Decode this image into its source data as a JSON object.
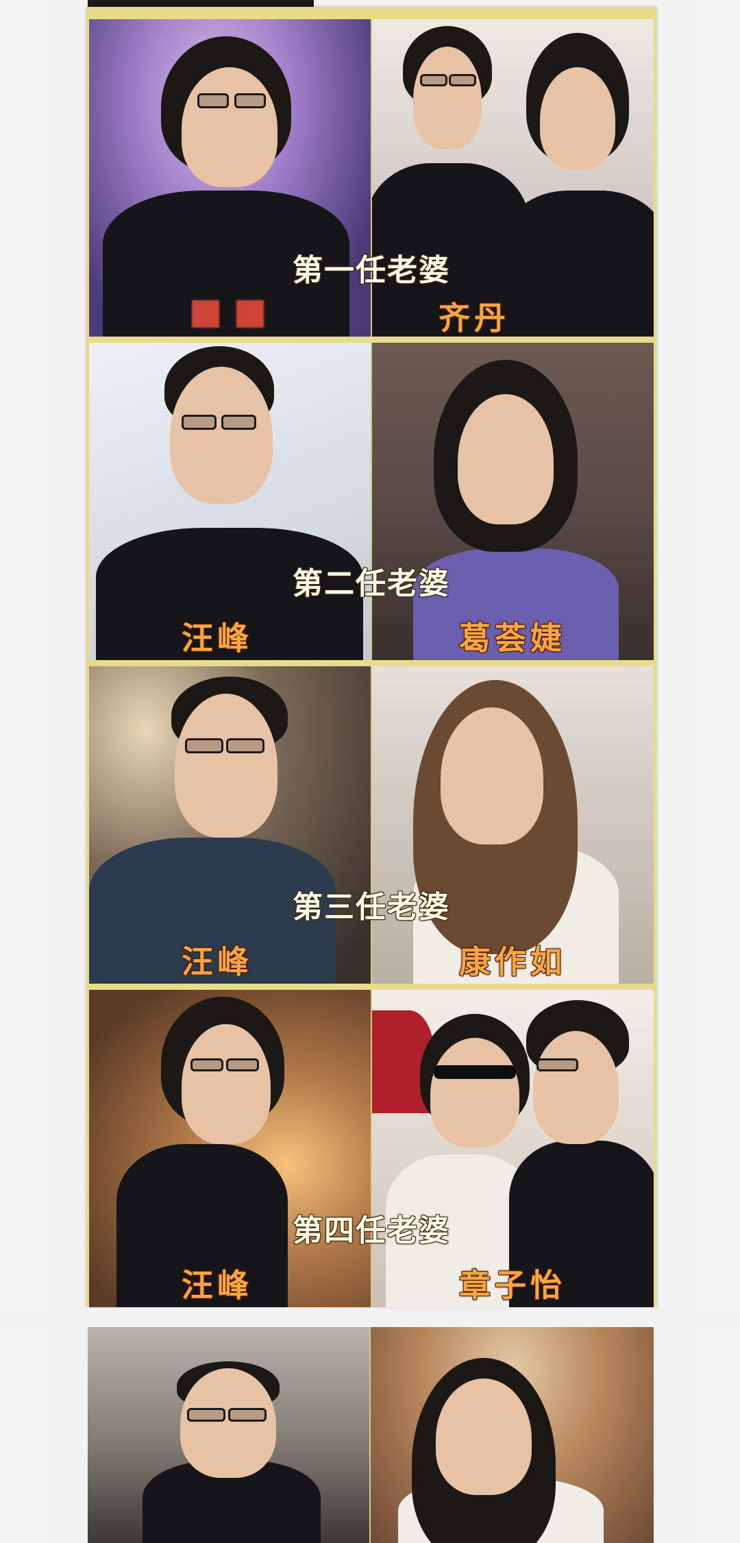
{
  "rows": [
    {
      "caption": "第一任老婆",
      "left_name": "",
      "right_name": "齐丹"
    },
    {
      "caption": "第二任老婆",
      "left_name": "汪峰",
      "right_name": "葛荟婕"
    },
    {
      "caption": "第三任老婆",
      "left_name": "汪峰",
      "right_name": "康作如"
    },
    {
      "caption": "第四任老婆",
      "left_name": "汪峰",
      "right_name": "章子怡"
    }
  ],
  "colors": {
    "caption_text": "#fffbe8",
    "name_text": "#f5a640",
    "frame": "#e8dc8a"
  }
}
